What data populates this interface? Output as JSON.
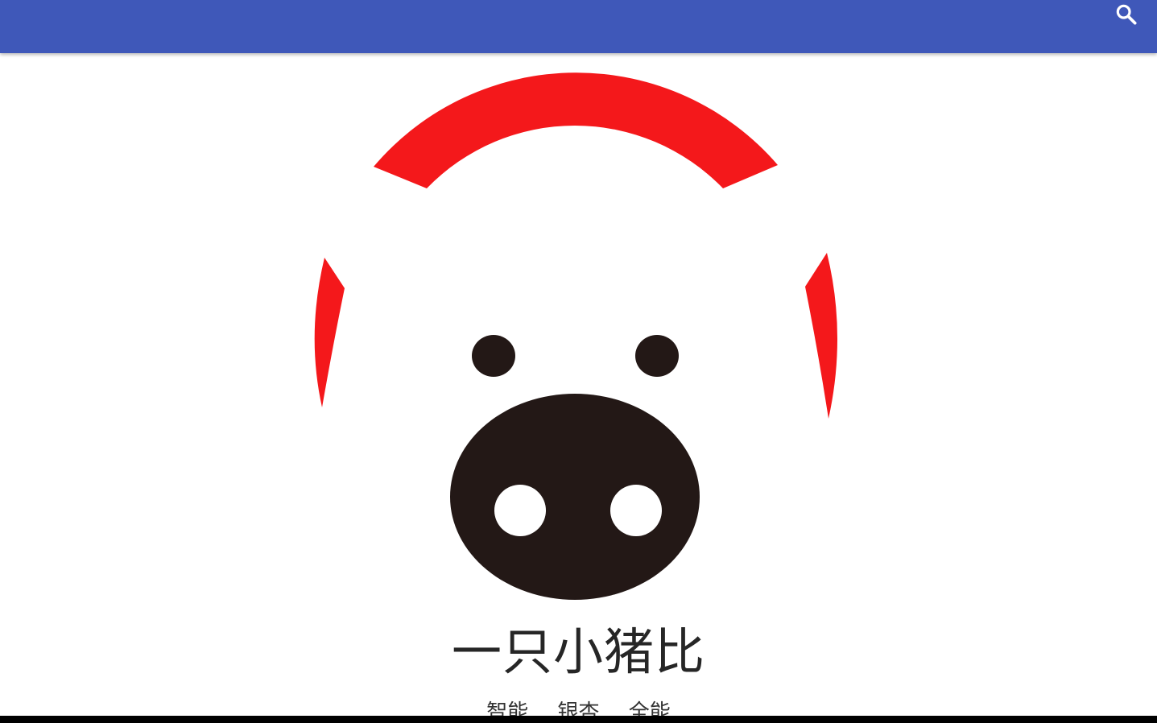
{
  "appbar": {
    "color": "#3f58b9",
    "search_icon": "search-icon"
  },
  "logo": {
    "ears_color": "#f4181b",
    "snout_color": "#231816",
    "icon": "pig-face-logo"
  },
  "title": "一只小猪比",
  "slogan": [
    "智能",
    "银杏",
    "全能"
  ]
}
